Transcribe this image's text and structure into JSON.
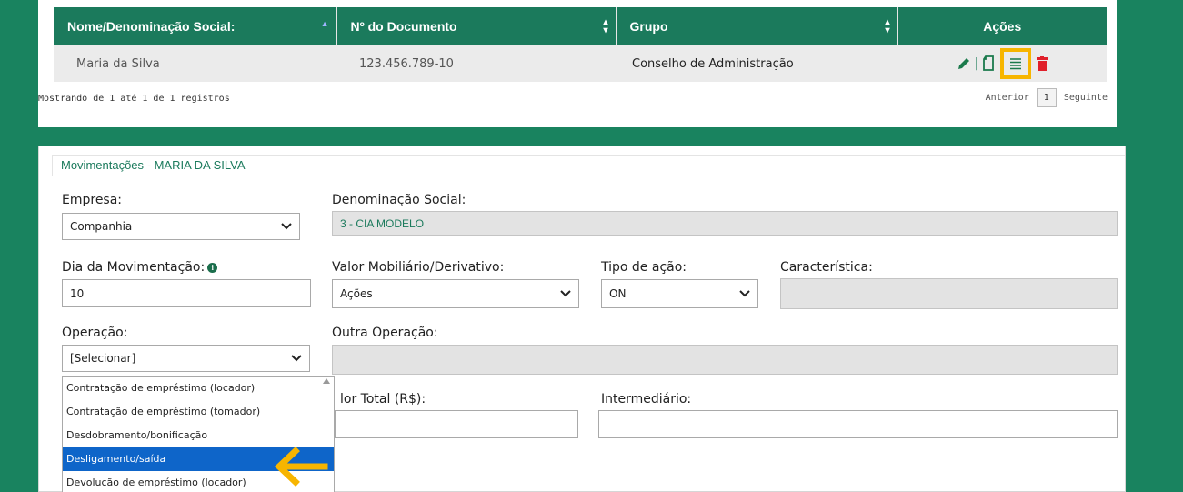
{
  "table": {
    "headers": [
      "Nome/Denominação Social:",
      "Nº do Documento",
      "Grupo",
      "Ações"
    ],
    "rows": [
      {
        "name": "Maria da Silva",
        "document": "123.456.789-10",
        "group": "Conselho de Administração"
      }
    ],
    "footer_text": "Mostrando de 1 até 1 de 1 registros",
    "pager": {
      "prev": "Anterior",
      "page": "1",
      "next": "Seguinte"
    }
  },
  "form": {
    "title": "Movimentações - MARIA DA SILVA",
    "empresa": {
      "label": "Empresa:",
      "value": "Companhia"
    },
    "denominacao": {
      "label": "Denominação Social:",
      "value": "3 - CIA MODELO"
    },
    "dia": {
      "label": "Dia da Movimentação:",
      "value": "10"
    },
    "valor_mobiliario": {
      "label": "Valor Mobiliário/Derivativo:",
      "value": "Ações"
    },
    "tipo_acao": {
      "label": "Tipo de ação:",
      "value": "ON"
    },
    "caracteristica": {
      "label": "Característica:",
      "value": ""
    },
    "operacao": {
      "label": "Operação:",
      "value": "[Selecionar]"
    },
    "outra_operacao": {
      "label": "Outra Operação:",
      "value": ""
    },
    "valor_total": {
      "label": "lor Total (R$):",
      "value": ""
    },
    "intermediario": {
      "label": "Intermediário:",
      "value": ""
    },
    "operacao_options": [
      "Contratação de empréstimo (locador)",
      "Contratação de empréstimo (tomador)",
      "Desdobramento/bonificação",
      "Desligamento/saída",
      "Devolução de empréstimo (locador)"
    ],
    "selected_option_index": 3
  },
  "colors": {
    "background": "#19835f",
    "header": "#1b7a5c",
    "highlight": "#f7b500",
    "selected_option": "#0e65c9",
    "delete_icon": "#e0202b"
  }
}
